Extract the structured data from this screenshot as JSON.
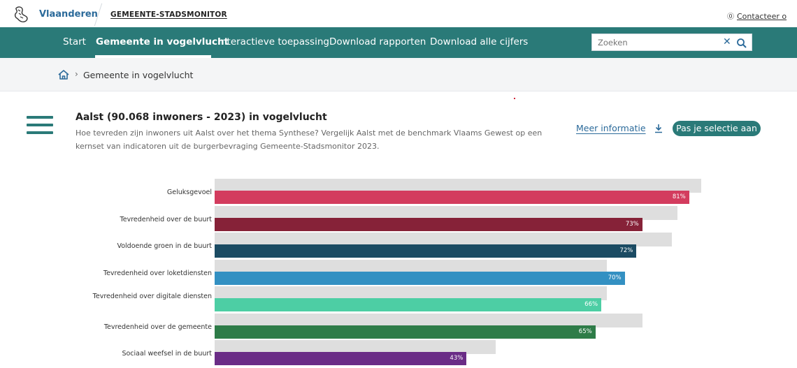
{
  "header": {
    "brand": "Vlaanderen",
    "site": "GEMEENTE-STADSMONITOR",
    "contact": "Contacteer o"
  },
  "nav": {
    "items": [
      {
        "label": "Start",
        "active": false
      },
      {
        "label": "Gemeente in vogelvlucht",
        "active": true
      },
      {
        "label": "Interactieve toepassing",
        "active": false
      },
      {
        "label": "Download rapporten",
        "active": false
      },
      {
        "label": "Download alle cijfers",
        "active": false
      }
    ],
    "search_placeholder": "Zoeken"
  },
  "breadcrumb": {
    "current": "Gemeente in vogelvlucht"
  },
  "page": {
    "title": "Aalst (90.068 inwoners - 2023) in vogelvlucht",
    "description": "Hoe tevreden zijn inwoners uit Aalst over het thema Synthese? Vergelijk Aalst met de benchmark Vlaams Gewest op een kernset van indicatoren uit de burgerbevraging Gemeente-Stadsmonitor 2023.",
    "more_info": "Meer informatie",
    "select_button": "Pas je selectie aan"
  },
  "colors": {
    "nav_bg": "#2a7a78",
    "link": "#2b6a9a",
    "benchmark": "#dedede"
  },
  "chart_data": {
    "type": "bar",
    "orientation": "horizontal",
    "categories": [
      "Geluksgevoel",
      "Tevredenheid over de buurt",
      "Voldoende groen in de buurt",
      "Tevredenheid over loketdiensten",
      "Tevredenheid over digitale diensten",
      "Tevredenheid over de gemeente",
      "Sociaal weefsel in de buurt"
    ],
    "series": [
      {
        "values": [
          81,
          73,
          72,
          70,
          66,
          65,
          43
        ],
        "labels": [
          "81%",
          "73%",
          "72%",
          "70%",
          "66%",
          "65%",
          "43%"
        ],
        "colors": [
          "#d33c5e",
          "#862238",
          "#1b4b63",
          "#3390c2",
          "#4dcea4",
          "#2e7c48",
          "#6a2c86"
        ]
      },
      {
        "values": [
          83,
          79,
          78,
          67,
          67,
          73,
          48
        ]
      }
    ],
    "xlim": [
      0,
      100
    ]
  }
}
